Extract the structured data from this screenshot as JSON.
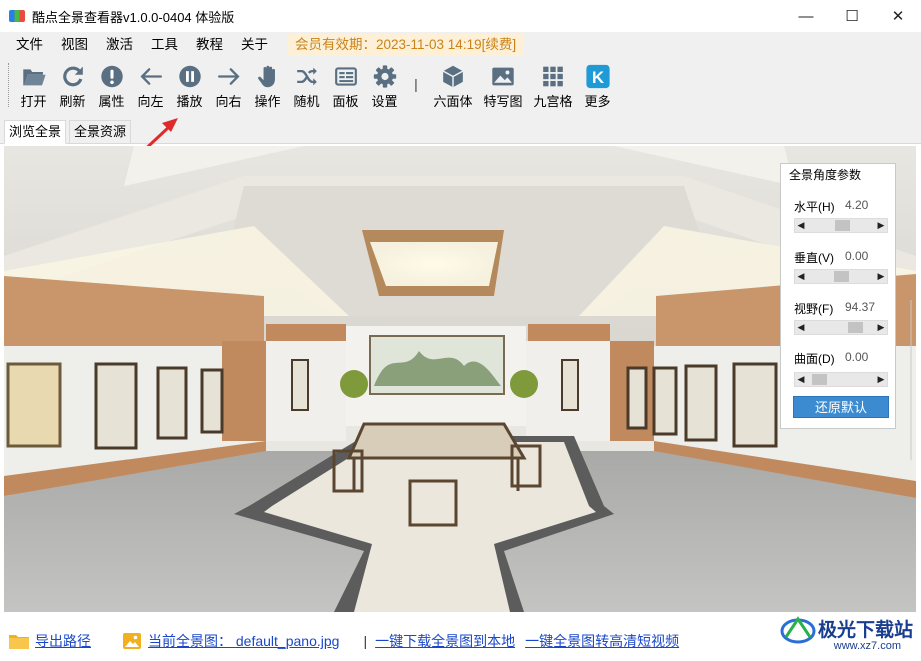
{
  "window": {
    "title": "酷点全景查看器v1.0.0-0404 体验版",
    "minimize_glyph": "—",
    "maximize_glyph": "☐",
    "close_glyph": "✕"
  },
  "menu": {
    "items": [
      "文件",
      "视图",
      "激活",
      "工具",
      "教程",
      "关于"
    ],
    "member_badge": "会员有效期：2023-11-03 14:19[续费]"
  },
  "toolbar": {
    "tools": [
      {
        "label": "打开",
        "icon": "folder-open-icon"
      },
      {
        "label": "刷新",
        "icon": "refresh-icon"
      },
      {
        "label": "属性",
        "icon": "info-icon"
      },
      {
        "label": "向左",
        "icon": "arrow-left-icon"
      },
      {
        "label": "播放",
        "icon": "pause-icon"
      },
      {
        "label": "向右",
        "icon": "arrow-right-icon"
      },
      {
        "label": "操作",
        "icon": "hand-icon"
      },
      {
        "label": "随机",
        "icon": "shuffle-icon"
      },
      {
        "label": "面板",
        "icon": "panel-icon"
      },
      {
        "label": "设置",
        "icon": "gear-icon"
      }
    ],
    "separator": "|",
    "tools2": [
      {
        "label": "六面体",
        "icon": "cube-icon"
      },
      {
        "label": "特写图",
        "icon": "image-icon"
      },
      {
        "label": "九宫格",
        "icon": "grid-icon"
      },
      {
        "label": "更多",
        "icon": "k-logo-icon",
        "glyph": "K"
      }
    ]
  },
  "tabs": [
    {
      "label": "浏览全景",
      "active": true
    },
    {
      "label": "全景资源",
      "active": false
    }
  ],
  "params": {
    "title": "全景角度参数",
    "items": [
      {
        "label": "水平(H)",
        "value": "4.20",
        "level": 0.52
      },
      {
        "label": "垂直(V)",
        "value": "0.00",
        "level": 0.5
      },
      {
        "label": "视野(F)",
        "value": "94.37",
        "level": 0.78
      },
      {
        "label": "曲面(D)",
        "value": "0.00",
        "level": 0.1
      }
    ],
    "reset_label": "还原默认"
  },
  "bottom": {
    "export_path": "导出路径",
    "current_pano": "当前全景图： default_pano.jpg",
    "separator": "|",
    "download_link": "一键下载全景图到本地",
    "video_link": "一键全景图转高清短视频"
  },
  "watermark": {
    "text": "极光下载站",
    "sub": "www.xz7.com"
  },
  "colors": {
    "accent": "#3c8ad0",
    "member_text": "#c9831a",
    "link": "#1a47c9"
  }
}
